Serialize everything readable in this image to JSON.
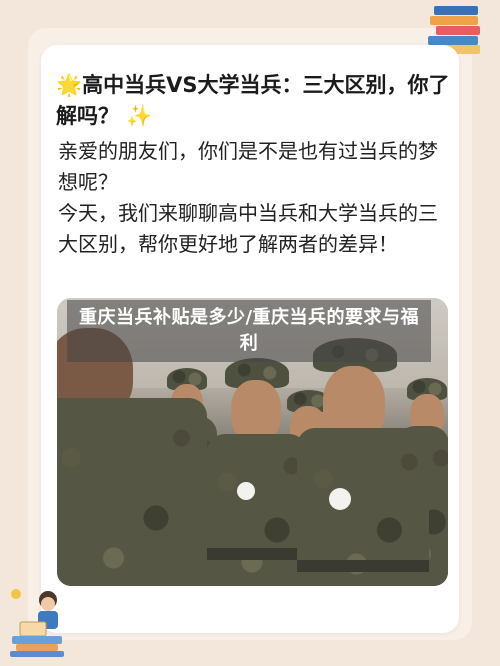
{
  "headline": {
    "lead_emoji": "🌟",
    "text": "高中当兵VS大学当兵：三大区别，你了解吗？",
    "trail_emoji": "✨"
  },
  "body": {
    "paragraphs": [
      "亲爱的朋友们，你们是不是也有过当兵的梦想呢？",
      "今天，我们来聊聊高中当兵和大学当兵的三大区别，帮你更好地了解两者的差异！"
    ]
  },
  "photo": {
    "overlay_title": "重庆当兵补贴是多少/重庆当兵的要求与福利",
    "icon": "soldiers-photo"
  },
  "decor": {
    "top_right": "books-icon",
    "bottom_left": "child-reading-icon"
  },
  "colors": {
    "background": "#f3e7dc",
    "card": "#ffffff",
    "overlay": "#464646"
  }
}
